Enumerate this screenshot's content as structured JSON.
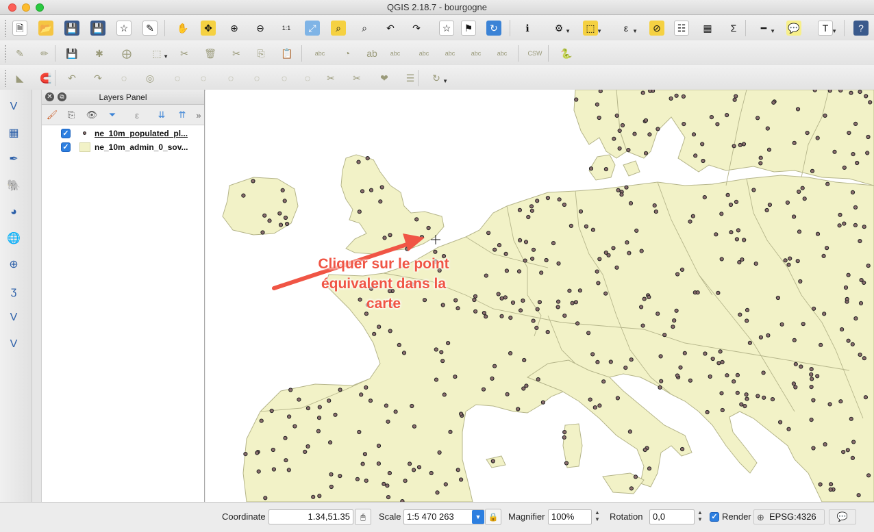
{
  "window": {
    "title": "QGIS 2.18.7 - bourgogne"
  },
  "colors": {
    "land": "#f2f2c7",
    "border": "#b5b58a",
    "point_fill": "#8a6d6d",
    "annotation": "#f05545",
    "accent": "#2d7fe0"
  },
  "toolbar1": [
    {
      "name": "new-project-icon",
      "glyph": "🗎",
      "bg": "#ffffff"
    },
    {
      "name": "open-project-icon",
      "glyph": "📂",
      "bg": "#f5c542"
    },
    {
      "name": "save-project-icon",
      "glyph": "💾",
      "bg": "#3a5a8c"
    },
    {
      "name": "save-as-icon",
      "glyph": "💾",
      "bg": "#3a5a8c"
    },
    {
      "name": "new-print-composer-icon",
      "glyph": "☆",
      "bg": "#ffffff"
    },
    {
      "name": "composer-manager-icon",
      "glyph": "✎",
      "bg": "#ffffff"
    },
    {
      "name": "pan-hand-icon",
      "glyph": "✋",
      "bg": "transparent"
    },
    {
      "name": "pan-to-selection-icon",
      "glyph": "✥",
      "bg": "#f5d142"
    },
    {
      "name": "zoom-in-icon",
      "glyph": "⊕",
      "bg": "transparent"
    },
    {
      "name": "zoom-out-icon",
      "glyph": "⊖",
      "bg": "transparent"
    },
    {
      "name": "zoom-native-icon",
      "glyph": "1:1",
      "bg": "transparent"
    },
    {
      "name": "zoom-full-icon",
      "glyph": "⤢",
      "bg": "#7fb4e6"
    },
    {
      "name": "zoom-to-selection-icon",
      "glyph": "⌕",
      "bg": "#f5d142"
    },
    {
      "name": "zoom-to-layer-icon",
      "glyph": "⌕",
      "bg": "transparent"
    },
    {
      "name": "zoom-last-icon",
      "glyph": "↶",
      "bg": "transparent"
    },
    {
      "name": "zoom-next-icon",
      "glyph": "↷",
      "bg": "transparent"
    },
    {
      "name": "new-bookmark-icon",
      "glyph": "☆",
      "bg": "#ffffff"
    },
    {
      "name": "show-bookmarks-icon",
      "glyph": "⚑",
      "bg": "#ffffff"
    },
    {
      "name": "refresh-icon",
      "glyph": "↻",
      "bg": "#3b83d6"
    },
    {
      "name": "identify-icon",
      "glyph": "ℹ",
      "bg": "transparent"
    },
    {
      "name": "run-feature-action-icon",
      "glyph": "⚙",
      "bg": "transparent"
    },
    {
      "name": "select-feature-icon",
      "glyph": "⬚",
      "bg": "#f5d142"
    },
    {
      "name": "select-by-expression-icon",
      "glyph": "ε",
      "bg": "transparent"
    },
    {
      "name": "deselect-icon",
      "glyph": "⊘",
      "bg": "#f5d142"
    },
    {
      "name": "attribute-table-icon",
      "glyph": "☷",
      "bg": "#ffffff"
    },
    {
      "name": "field-calculator-icon",
      "glyph": "▦",
      "bg": "transparent"
    },
    {
      "name": "statistics-icon",
      "glyph": "Σ",
      "bg": "transparent"
    },
    {
      "name": "measure-icon",
      "glyph": "━",
      "bg": "transparent"
    },
    {
      "name": "map-tips-icon",
      "glyph": "💬",
      "bg": "#f7ef8a"
    },
    {
      "name": "text-annotation-icon",
      "glyph": "T",
      "bg": "#ffffff"
    },
    {
      "name": "help-icon",
      "glyph": "?",
      "bg": "#3a5a8c"
    }
  ],
  "toolbar2": [
    {
      "name": "toggle-editing-icon",
      "glyph": "✎"
    },
    {
      "name": "edit-pencil-icon",
      "glyph": "✏"
    },
    {
      "name": "save-edits-icon",
      "glyph": "💾"
    },
    {
      "name": "add-feature-icon",
      "glyph": "✱"
    },
    {
      "name": "move-feature-icon",
      "glyph": "⨁"
    },
    {
      "name": "node-tool-icon",
      "glyph": "⬚"
    },
    {
      "name": "edit-node-icon",
      "glyph": "✂"
    },
    {
      "name": "delete-selected-icon",
      "glyph": "🗑"
    },
    {
      "name": "cut-features-icon",
      "glyph": "✂"
    },
    {
      "name": "copy-features-icon",
      "glyph": "⎘"
    },
    {
      "name": "paste-features-icon",
      "glyph": "📋"
    },
    {
      "name": "label-abc-icon",
      "glyph": "abc"
    },
    {
      "name": "layer-diagram-icon",
      "glyph": "◔"
    },
    {
      "name": "label-highlight-icon",
      "glyph": "ab"
    },
    {
      "name": "pin-labels-icon",
      "glyph": "abc"
    },
    {
      "name": "show-hide-labels-icon",
      "glyph": "abc"
    },
    {
      "name": "move-label-icon",
      "glyph": "abc"
    },
    {
      "name": "rotate-label-icon",
      "glyph": "abc"
    },
    {
      "name": "change-label-icon",
      "glyph": "abc"
    },
    {
      "name": "csw-icon",
      "glyph": "CSW"
    },
    {
      "name": "python-console-icon",
      "glyph": "🐍"
    }
  ],
  "toolbar3": [
    {
      "name": "measure-angle-icon",
      "glyph": "◣"
    },
    {
      "name": "snapping-magnet-icon",
      "glyph": "🧲"
    },
    {
      "name": "undo-icon",
      "glyph": "↶"
    },
    {
      "name": "redo-icon",
      "glyph": "↷"
    },
    {
      "name": "simplify-feature-icon",
      "glyph": "◌"
    },
    {
      "name": "add-ring-icon",
      "glyph": "◎"
    },
    {
      "name": "add-part-icon",
      "glyph": "◌"
    },
    {
      "name": "fill-ring-icon",
      "glyph": "◌"
    },
    {
      "name": "delete-ring-icon",
      "glyph": "◌"
    },
    {
      "name": "delete-part-icon",
      "glyph": "◌"
    },
    {
      "name": "reshape-features-icon",
      "glyph": "◌"
    },
    {
      "name": "offset-curve-icon",
      "glyph": "◌"
    },
    {
      "name": "split-features-icon",
      "glyph": "✂"
    },
    {
      "name": "split-parts-icon",
      "glyph": "✂"
    },
    {
      "name": "merge-selected-icon",
      "glyph": "❤"
    },
    {
      "name": "merge-attributes-icon",
      "glyph": "☰"
    },
    {
      "name": "rotate-point-symbols-icon",
      "glyph": "↻"
    }
  ],
  "vtools": [
    {
      "name": "add-vector-layer-icon",
      "glyph": "V"
    },
    {
      "name": "add-raster-layer-icon",
      "glyph": "▦"
    },
    {
      "name": "add-delimited-text-icon",
      "glyph": "✒"
    },
    {
      "name": "add-postgis-layer-icon",
      "glyph": "🐘"
    },
    {
      "name": "add-spatialite-layer-icon",
      "glyph": "◕"
    },
    {
      "name": "add-wms-layer-icon",
      "glyph": "🌐"
    },
    {
      "name": "add-wfs-layer-icon",
      "glyph": "⊕"
    },
    {
      "name": "add-virtual-layer-icon",
      "glyph": "ʒ"
    },
    {
      "name": "new-shapefile-icon",
      "glyph": "V"
    },
    {
      "name": "new-temporary-layer-icon",
      "glyph": "V"
    }
  ],
  "layers_panel": {
    "title": "Layers Panel",
    "layers": [
      {
        "name": "ne_10m_populated_pl...",
        "visible": true,
        "symbol": "point"
      },
      {
        "name": "ne_10m_admin_0_sov...",
        "visible": true,
        "symbol": "polygon"
      }
    ]
  },
  "map": {
    "annotation_lines": [
      "Cliquer sur le point",
      "équivalent dans la",
      "carte"
    ]
  },
  "statusbar": {
    "coordinate_label": "Coordinate",
    "coordinate_value": "1.34,51.35",
    "scale_label": "Scale",
    "scale_value": "1:5 470 263",
    "magnifier_label": "Magnifier",
    "magnifier_value": "100%",
    "rotation_label": "Rotation",
    "rotation_value": "0,0",
    "render_label": "Render",
    "render_checked": true,
    "crs_label": "EPSG:4326"
  }
}
